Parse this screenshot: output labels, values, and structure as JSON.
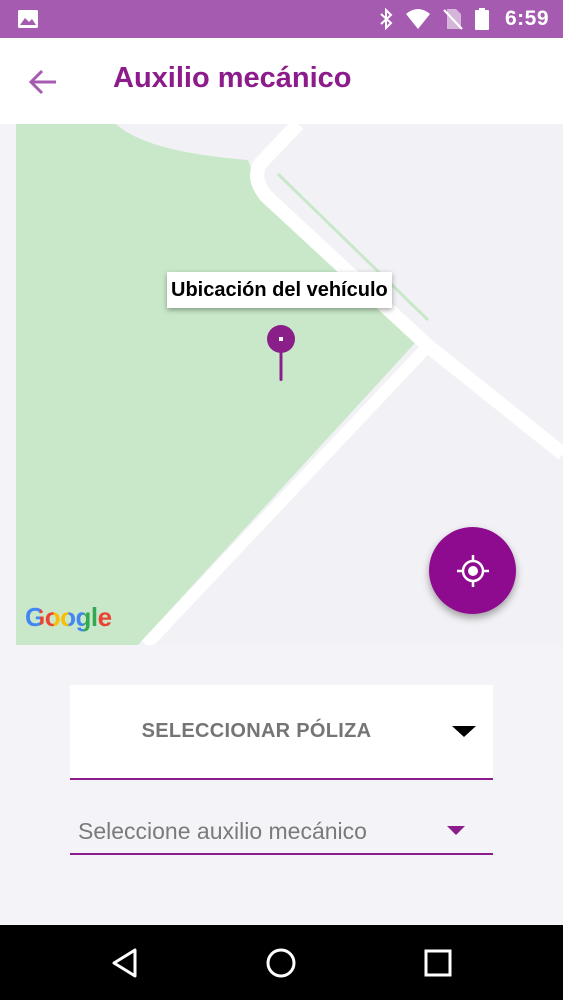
{
  "status_bar": {
    "time": "6:59",
    "left_icon": "image-icon",
    "icons": [
      "bluetooth-icon",
      "wifi-icon",
      "no-sim-icon",
      "battery-icon"
    ],
    "background": "#a55bb0"
  },
  "app_bar": {
    "title": "Auxilio mecánico",
    "back_icon": "arrow-back-icon",
    "title_color": "#8c1b8c"
  },
  "map": {
    "marker_label": "Ubicación del vehículo",
    "marker_icon": "map-pin-icon",
    "attribution": "Google",
    "locate_button_icon": "my-location-icon",
    "park_color": "#c9e8c9",
    "accent_color": "#8e0a8e"
  },
  "form": {
    "policy_select_label": "SELECCIONAR PÓLIZA",
    "assist_select_placeholder": "Seleccione auxilio mecánico"
  },
  "nav_bar": {
    "buttons": [
      "back-triangle-icon",
      "home-circle-icon",
      "recents-square-icon"
    ]
  }
}
